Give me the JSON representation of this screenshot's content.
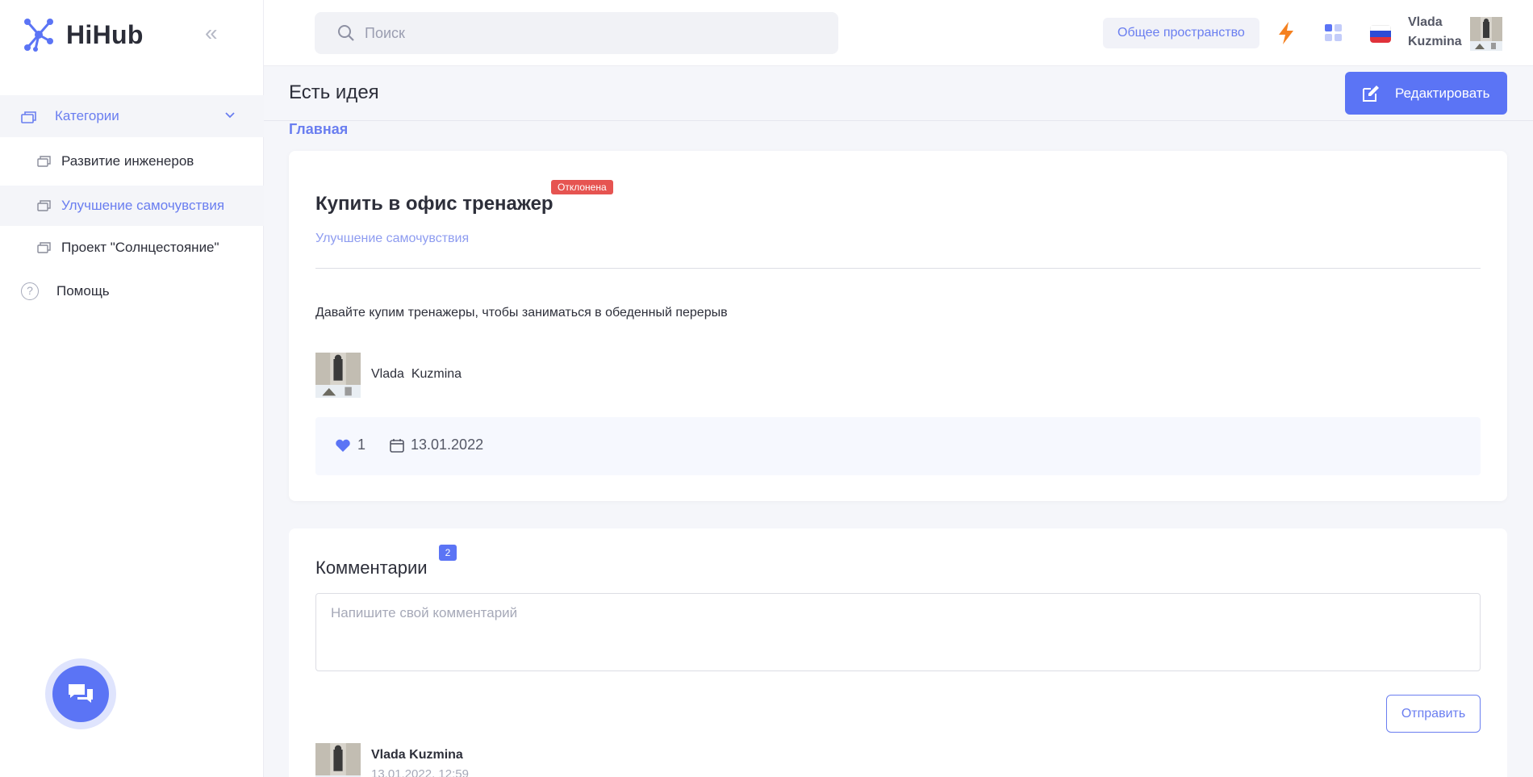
{
  "app": {
    "name": "HiHub"
  },
  "sidebar": {
    "categories_label": "Категории",
    "items": [
      {
        "label": "Развитие инженеров",
        "active": false
      },
      {
        "label": "Улучшение самочувствия",
        "active": true
      },
      {
        "label": "Проект \"Солнцестояние\"",
        "active": false
      }
    ],
    "help_label": "Помощь"
  },
  "header": {
    "search_placeholder": "Поиск",
    "workspace_label": "Общее пространство",
    "user_first": "Vlada",
    "user_last": "Kuzmina"
  },
  "page": {
    "title": "Есть идея",
    "edit_label": "Редактировать",
    "breadcrumb": "Главная"
  },
  "idea": {
    "title": "Купить в офис тренажер",
    "status": "Отклонена",
    "category": "Улучшение самочувствия",
    "text": "Давайте купим тренажеры, чтобы заниматься в обеденный перерыв",
    "author": "Vlada  Kuzmina",
    "likes": "1",
    "date": "13.01.2022"
  },
  "comments": {
    "title": "Комментарии",
    "count": "2",
    "placeholder": "Напишите свой комментарий",
    "send_label": "Отправить",
    "first": {
      "author": "Vlada Kuzmina",
      "date": "13.01.2022, 12:59"
    }
  },
  "colors": {
    "accent": "#5b74f5",
    "rejected": "#e65451",
    "bolt": "#f5801f"
  }
}
